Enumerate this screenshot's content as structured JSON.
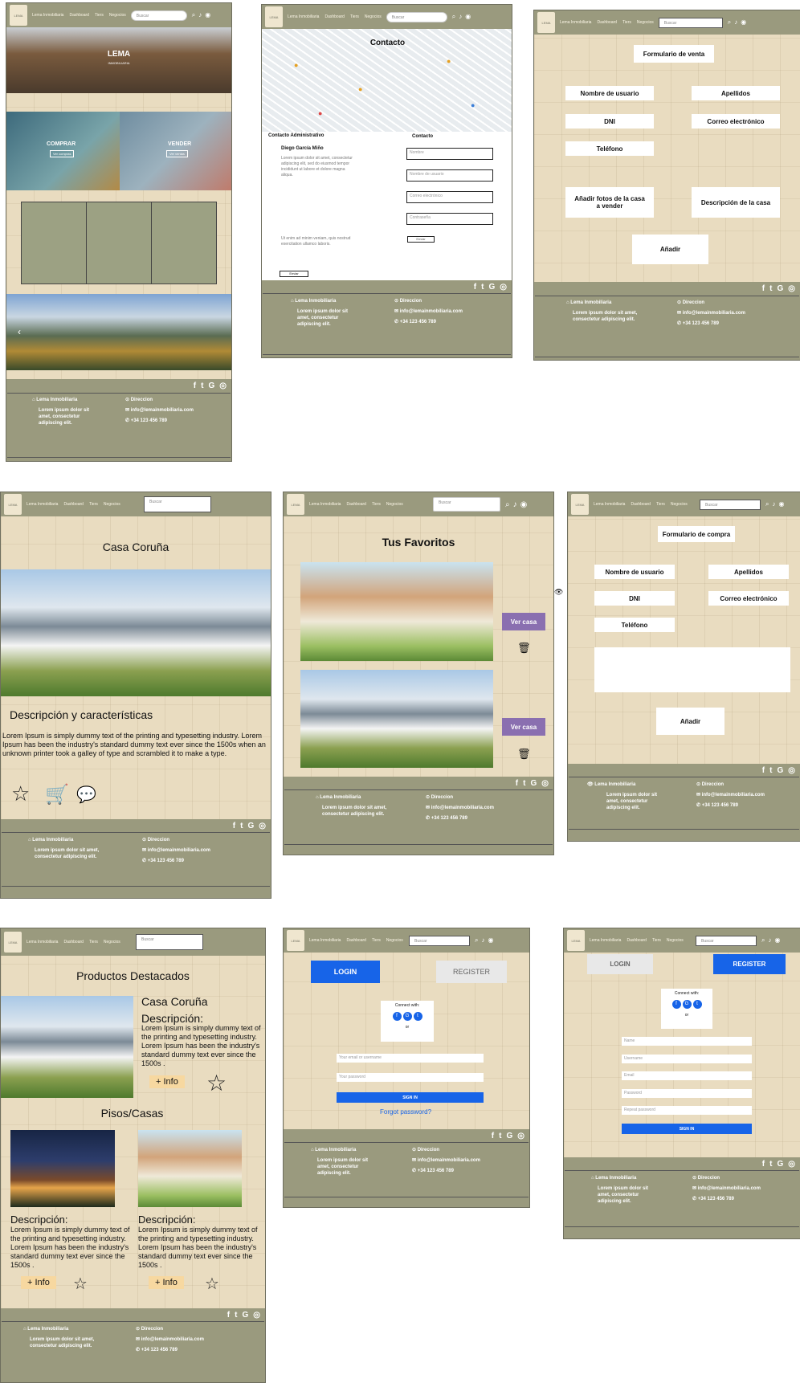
{
  "header": {
    "nav": [
      "Lema Inmobiliaria",
      "Dashboard",
      "Tiers",
      "Negocios"
    ],
    "search": "Buscar"
  },
  "footer": {
    "brand": "Lema Inmobiliaria",
    "blurb": "Lorem ipsum dolor sit amet, consectetur adipiscing elit.",
    "address": "Direccion",
    "email": "info@lemainmobiliaria.com",
    "phone": "+34 123 456 789",
    "social": [
      "f",
      "t",
      "G",
      "◎"
    ]
  },
  "home": {
    "hero_title": "LEMA",
    "hero_sub": "INMOBILIARIA",
    "buy": "COMPRAR",
    "buy_btn": "Ver compras",
    "sell": "VENDER",
    "sell_btn": "Ver ventas"
  },
  "contact": {
    "title": "Contacto",
    "admin_title": "Contacto Administrativo",
    "admin_name": "Diego García Miño",
    "admin_text": "Lorem ipsum dolor sit amet, consectetur adipiscing elit, sed do eiusmod tempor incididunt ut labore et dolore magna aliqua.",
    "admin_text2": "Ut enim ad minim veniam, quis nostrud exercitation ullamco laboris.",
    "admin_btn": "Enviar",
    "form_title": "Contacto",
    "fields": [
      "Nombre",
      "Nombre de usuario",
      "Correo electrónico",
      "Contraseña"
    ],
    "send": "Enviar"
  },
  "sale": {
    "title": "Formulario de venta",
    "username": "Nombre de usuario",
    "surname": "Apellidos",
    "dni": "DNI",
    "email": "Correo electrónico",
    "phone": "Teléfono",
    "photos": "Añadir fotos de la casa a vender",
    "desc": "Descripción de la casa",
    "add": "Añadir"
  },
  "house": {
    "title": "Casa Coruña",
    "desc_title": "Descripción y características",
    "desc": "Lorem Ipsum is simply dummy text of the printing and typesetting industry. Lorem Ipsum has been the industry's standard dummy text ever since the 1500s when an unknown printer took a galley of type and scrambled it to make a type."
  },
  "favs": {
    "title": "Tus Favoritos",
    "btn": "Ver casa"
  },
  "buy": {
    "title": "Formulario de compra",
    "username": "Nombre de usuario",
    "surname": "Apellidos",
    "dni": "DNI",
    "email": "Correo electrónico",
    "phone": "Teléfono",
    "add": "Añadir"
  },
  "featured": {
    "title": "Productos Destacados",
    "house_name": "Casa Coruña",
    "desc_label": "Descripción:",
    "desc": "Lorem Ipsum is simply dummy text of the printing and typesetting industry.  Lorem Ipsum has been the industry's standard dummy text ever since the 1500s .",
    "info": "+ Info",
    "section2": "Pisos/Casas"
  },
  "login": {
    "login": "LOGIN",
    "register": "REGISTER",
    "connect": "Connect with:",
    "or": "or",
    "user_ph": "Your email or username",
    "pass_ph": "Your password",
    "signin": "SIGN IN",
    "forgot": "Forgot password?"
  },
  "register": {
    "login": "LOGIN",
    "register": "REGISTER",
    "connect": "Connect with:",
    "or": "or",
    "fields": [
      "Name",
      "Username",
      "Email",
      "Password",
      "Repeat password"
    ],
    "signin": "SIGN IN"
  }
}
